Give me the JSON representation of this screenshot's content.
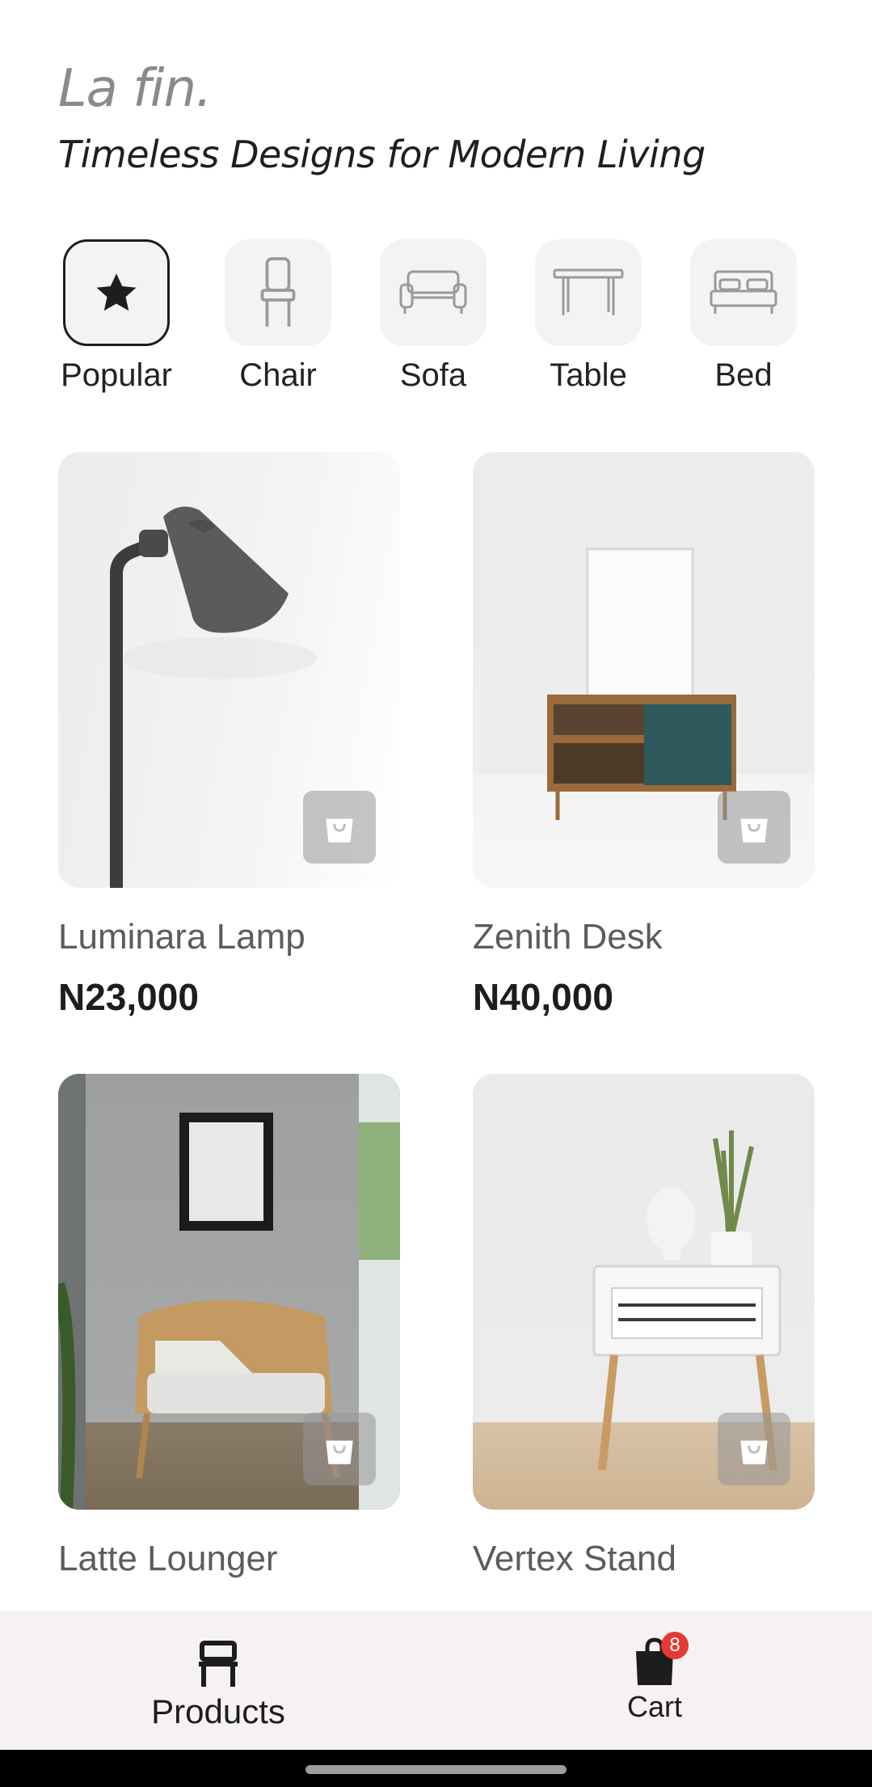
{
  "header": {
    "brand": "La fin.",
    "tagline": "Timeless Designs for Modern Living"
  },
  "categories": [
    {
      "label": "Popular",
      "icon": "star-icon",
      "active": true
    },
    {
      "label": "Chair",
      "icon": "chair-icon",
      "active": false
    },
    {
      "label": "Sofa",
      "icon": "sofa-icon",
      "active": false
    },
    {
      "label": "Table",
      "icon": "table-icon",
      "active": false
    },
    {
      "label": "Bed",
      "icon": "bed-icon",
      "active": false
    }
  ],
  "products": [
    {
      "name": "Luminara Lamp",
      "price": "N23,000"
    },
    {
      "name": "Zenith Desk",
      "price": "N40,000"
    },
    {
      "name": "Latte Lounger",
      "price": ""
    },
    {
      "name": "Vertex Stand",
      "price": ""
    }
  ],
  "nav": {
    "products_label": "Products",
    "cart_label": "Cart",
    "cart_count": "8"
  },
  "colors": {
    "background": "#ffffff",
    "accent_dark": "#1d1d1d",
    "badge": "#e53935",
    "nav_background": "#f6f2f4"
  }
}
